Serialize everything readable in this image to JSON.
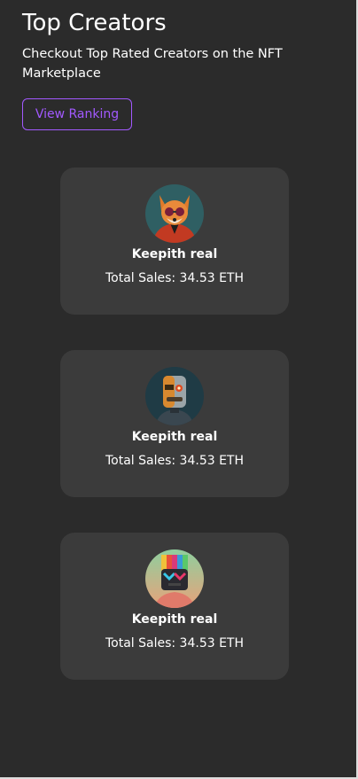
{
  "header": {
    "title": "Top Creators",
    "subtitle": "Checkout Top Rated Creators on the NFT Marketplace"
  },
  "actions": {
    "view_ranking_label": "View Ranking"
  },
  "creators": [
    {
      "name": "Keepith real",
      "sales": "Total Sales: 34.53 ETH",
      "avatar": "fox-avatar-icon"
    },
    {
      "name": "Keepith real",
      "sales": "Total Sales: 34.53 ETH",
      "avatar": "robot-avatar-icon"
    },
    {
      "name": "Keepith real",
      "sales": "Total Sales: 34.53 ETH",
      "avatar": "rainbow-robot-avatar-icon"
    }
  ],
  "colors": {
    "background": "#2b2b2b",
    "card": "#3b3b3b",
    "accent": "#a259ff",
    "text": "#ffffff"
  }
}
